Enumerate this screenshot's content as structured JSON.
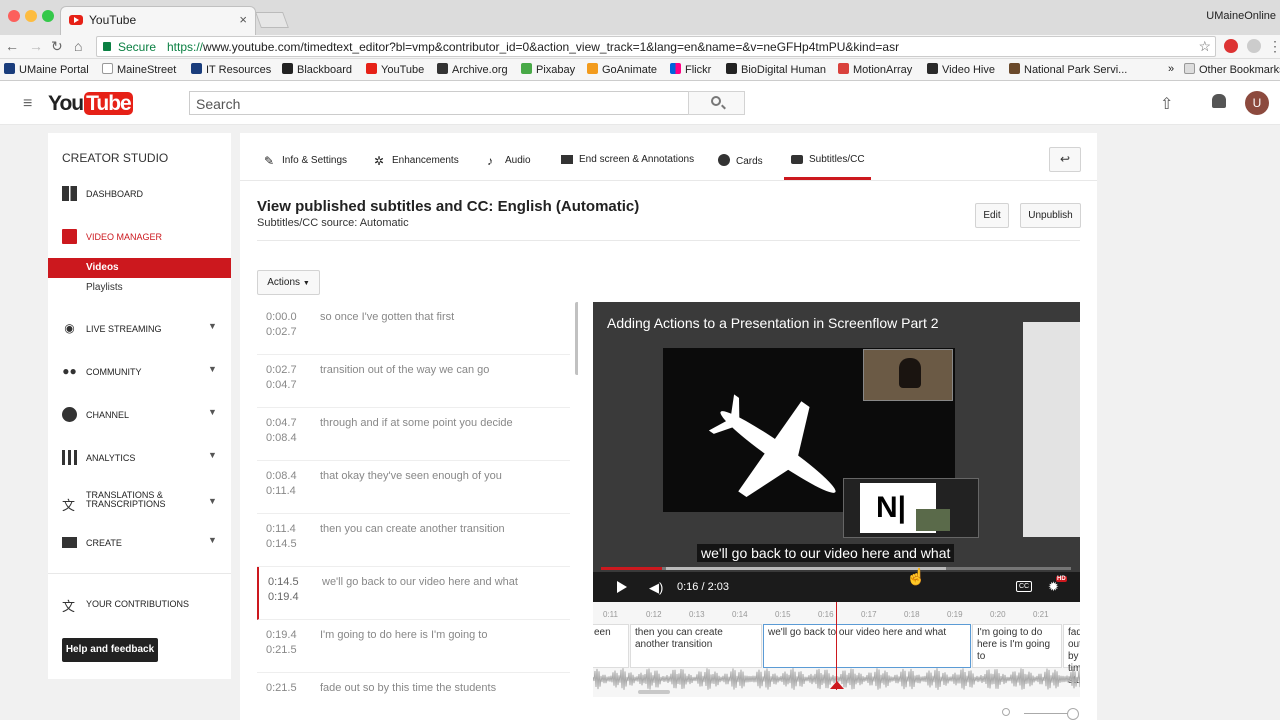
{
  "browser": {
    "tab_title": "YouTube",
    "tab_close": "×",
    "profile": "UMaineOnline",
    "secure_label": "Secure",
    "url_scheme": "https://",
    "url_rest": "www.youtube.com/timedtext_editor?bl=vmp&contributor_id=0&action_view_track=1&lang=en&name=&v=neGFHp4tmPU&kind=asr",
    "bookmarks": [
      "UMaine Portal",
      "MaineStreet",
      "IT Resources",
      "Blackboard",
      "YouTube",
      "Archive.org",
      "Pixabay",
      "GoAnimate",
      "Flickr",
      "BioDigital Human",
      "MotionArray",
      "Video Hive",
      "National Park Servi...",
      "»",
      "Other Bookmarks"
    ]
  },
  "header": {
    "logo_you": "You",
    "logo_tube": "Tube",
    "search_placeholder": "Search",
    "avatar_letter": "U"
  },
  "sidebar": {
    "title": "CREATOR STUDIO",
    "items": [
      {
        "label": "DASHBOARD",
        "icon": "dashboard-icon"
      },
      {
        "label": "VIDEO MANAGER",
        "icon": "video-manager-icon"
      },
      {
        "label": "LIVE STREAMING",
        "icon": "live-icon"
      },
      {
        "label": "COMMUNITY",
        "icon": "community-icon"
      },
      {
        "label": "CHANNEL",
        "icon": "channel-icon"
      },
      {
        "label": "ANALYTICS",
        "icon": "analytics-icon"
      },
      {
        "label": "TRANSLATIONS & TRANSCRIPTIONS",
        "icon": "translate-icon"
      },
      {
        "label": "CREATE",
        "icon": "create-icon"
      },
      {
        "label": "YOUR CONTRIBUTIONS",
        "icon": "contributions-icon"
      }
    ],
    "sub_videos": "Videos",
    "sub_playlists": "Playlists",
    "help_button": "Help and feedback"
  },
  "tabs": [
    "Info & Settings",
    "Enhancements",
    "Audio",
    "End screen & Annotations",
    "Cards",
    "Subtitles/CC"
  ],
  "page": {
    "title": "View published subtitles and CC: English (Automatic)",
    "subtitle": "Subtitles/CC source: Automatic",
    "edit_button": "Edit",
    "unpublish_button": "Unpublish",
    "actions_button": "Actions"
  },
  "captions": [
    {
      "start": "0:00.0",
      "end": "0:02.7",
      "text": "so once I've gotten that first"
    },
    {
      "start": "0:02.7",
      "end": "0:04.7",
      "text": "transition out of the way we can go"
    },
    {
      "start": "0:04.7",
      "end": "0:08.4",
      "text": "through and if at some point you decide"
    },
    {
      "start": "0:08.4",
      "end": "0:11.4",
      "text": "that okay they've seen enough of you"
    },
    {
      "start": "0:11.4",
      "end": "0:14.5",
      "text": "then you can create another transition"
    },
    {
      "start": "0:14.5",
      "end": "0:19.4",
      "text": "we'll go back to our video here and what"
    },
    {
      "start": "0:19.4",
      "end": "0:21.5",
      "text": "I'm going to do here is I'm going to"
    },
    {
      "start": "0:21.5",
      "end": "",
      "text": "fade out so by this time the students"
    }
  ],
  "video": {
    "title": "Adding Actions to a Presentation in Screenflow Part 2",
    "subtitle": "we'll go back to our video here and what",
    "time": "0:16 / 2:03",
    "progress_fraction": 0.13,
    "cc_label": "CC",
    "hd_label": "HD"
  },
  "timeline": {
    "ticks": [
      "0:11",
      "0:12",
      "0:13",
      "0:14",
      "0:15",
      "0:16",
      "0:17",
      "0:18",
      "0:19",
      "0:20",
      "0:21"
    ],
    "segments": [
      "een",
      "then you can create another transition",
      "we'll go back to our video here and what",
      "I'm going to do here is I'm going to",
      "fade out so by this time stu"
    ]
  }
}
